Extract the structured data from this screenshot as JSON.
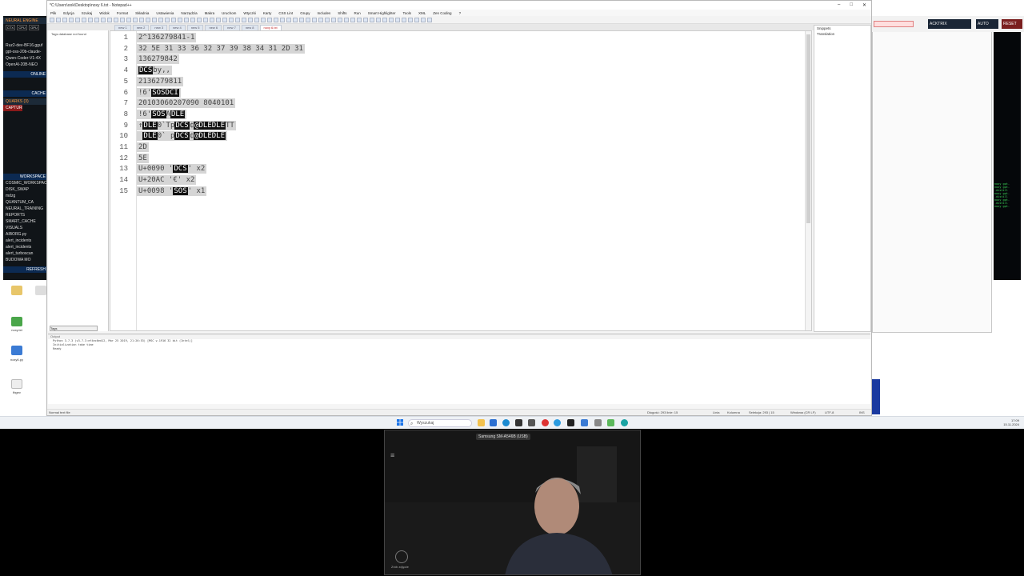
{
  "notepad": {
    "title": "*C:\\Users\\ook\\Desktop\\noxy 6.txt - Notepad++",
    "menu": [
      "Plik",
      "Edycja",
      "Szukaj",
      "Widok",
      "Format",
      "Składnia",
      "Ustawienia",
      "Narzędzia",
      "Makra",
      "Uruchom",
      "Wtyczki",
      "Karty",
      "CSS Lint",
      "Grupy",
      "Includes",
      "Shifts",
      "Run",
      "Smart Highlighter",
      "Tools",
      "XML",
      "Zen Coding",
      "?"
    ],
    "tabs": [
      "new 1",
      "new 2",
      "new 3",
      "new 4",
      "new 5",
      "new 6",
      "new 7",
      "new 8",
      "noxy 6.txt"
    ],
    "function_list_msg": "Tags database not found",
    "tags_tab": "Tags",
    "lines": [
      {
        "n": "1",
        "segs": [
          {
            "t": "2^136279841-1",
            "c": false
          }
        ]
      },
      {
        "n": "2",
        "segs": [
          {
            "t": "32 5E 31 33 36 32 37 39 38 34 31 2D 31",
            "c": false
          }
        ]
      },
      {
        "n": "3",
        "segs": [
          {
            "t": "136279842",
            "c": false
          }
        ]
      },
      {
        "n": "4",
        "segs": [
          {
            "t": "DCS",
            "c": true
          },
          {
            "t": "by,,",
            "c": false
          }
        ]
      },
      {
        "n": "5",
        "segs": [
          {
            "t": "2136279811",
            "c": false
          }
        ]
      },
      {
        "n": "6",
        "segs": [
          {
            "t": "!6'",
            "c": false
          },
          {
            "t": "SOSDCI",
            "c": true
          }
        ]
      },
      {
        "n": "7",
        "segs": [
          {
            "t": "20103060207090 8040101",
            "c": false
          }
        ]
      },
      {
        "n": "8",
        "segs": [
          {
            "t": "!6'",
            "c": false
          },
          {
            "t": "SOS",
            "c": true
          },
          {
            "t": "A",
            "c": false
          },
          {
            "t": "DLE",
            "c": true
          }
        ]
      },
      {
        "n": "9",
        "segs": [
          {
            "t": "↑",
            "c": false
          },
          {
            "t": "DLE",
            "c": true
          },
          {
            "t": "0`Tp",
            "c": false
          },
          {
            "t": "DCS",
            "c": true
          },
          {
            "t": "¢",
            "c": false
          },
          {
            "t": "@DLEDLE",
            "c": true
          },
          {
            "t": "TT",
            "c": false
          }
        ]
      },
      {
        "n": "10",
        "segs": [
          {
            "t": " ",
            "c": false
          },
          {
            "t": "DLE",
            "c": true
          },
          {
            "t": "0` p",
            "c": false
          },
          {
            "t": "DCS",
            "c": true
          },
          {
            "t": "¢",
            "c": false
          },
          {
            "t": "@DLEDLE",
            "c": true
          }
        ]
      },
      {
        "n": "11",
        "segs": [
          {
            "t": "2D",
            "c": false
          }
        ]
      },
      {
        "n": "12",
        "segs": [
          {
            "t": "5E",
            "c": false
          }
        ]
      },
      {
        "n": "13",
        "segs": [
          {
            "t": "U+0090 '",
            "c": false
          },
          {
            "t": "DCS",
            "c": true
          },
          {
            "t": "' x2",
            "c": false
          }
        ]
      },
      {
        "n": "14",
        "segs": [
          {
            "t": "U+20AC '€' x2",
            "c": false
          }
        ]
      },
      {
        "n": "15",
        "segs": [
          {
            "t": "U+0098 '",
            "c": false
          },
          {
            "t": "SOS",
            "c": true
          },
          {
            "t": "' x1",
            "c": false
          }
        ]
      }
    ],
    "snippets_title": "Snippets",
    "snippets_sub": "Translation",
    "output_title": "Output",
    "output_lines": [
      "Python 3.7.3 (v3.7.3:ef4ec6ed12, Mar 25 2019, 21:26:53) [MSC v.1916 32 bit (Intel)]",
      "Initialization take time",
      "Ready"
    ],
    "status": {
      "left": "Normal text file",
      "length": "Długość: 293   linie: 15",
      "ln": "Linia",
      "col": "Kolumna",
      "sel": "Selekcja: 293 | 15",
      "eol": "Windows (CR LF)",
      "enc": "UTF-8",
      "ins": "INS"
    }
  },
  "left_panel": {
    "title": "NEURAL ENGINE",
    "stats": [
      "CTX",
      "CPU",
      "GPU"
    ],
    "models": [
      "Ruz2-dev-BF16.gguf",
      "gpt-oss-20b-claude-",
      "Qwen-Coder-V1-4X",
      "OpenAI-20B-NEO"
    ],
    "online": "ONLINE",
    "cache": "CACHE",
    "quarks": "QUARKS (3)",
    "capture": "CAPTURE",
    "workspace": "WORKSPACE",
    "tree": [
      "COSMIC_WORKSPACE",
      "DISK_SWAP",
      "mdzg",
      "QUANTUM_CA",
      "NEURAL_TRAINING",
      "REPORTS",
      "SMART_CACHE",
      "VISUALS",
      "AIBORG.py",
      "alert_incidents",
      "alert_incidents",
      "alert_turboscan",
      "BUDOWA MO"
    ],
    "refresh": "REFRESH"
  },
  "right_top": {
    "btn1": "ACKTRIX",
    "btn2": "AUTO",
    "btn3": "RESET"
  },
  "terminal_lines": [
    "noxy gpt-",
    "noxy gpt-",
    "-distill",
    "noxy gpt-",
    "-distill",
    "noxy gpt-",
    "-distill",
    "noxy gpt-"
  ],
  "taskbar": {
    "search_placeholder": "Wyszukaj",
    "time": "17:09",
    "date": "15.11.2024"
  },
  "webcam": {
    "label": "Samsung SM-A546B (USB)",
    "btn_label": "Zrób zdjęcie"
  },
  "desktop_icons": [
    "noxy.txt",
    "noxy6.py",
    "fbgev"
  ]
}
